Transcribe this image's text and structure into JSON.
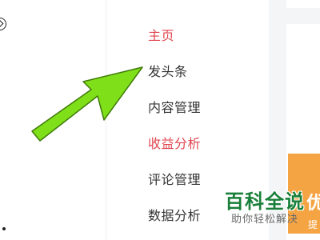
{
  "nav": {
    "items": [
      {
        "label": "主页",
        "active": true
      },
      {
        "label": "发头条",
        "active": false
      },
      {
        "label": "内容管理",
        "active": false
      },
      {
        "label": "收益分析",
        "active": true
      },
      {
        "label": "评论管理",
        "active": false
      },
      {
        "label": "数据分析",
        "active": false
      }
    ]
  },
  "watermark": {
    "title": "百科全说",
    "subtitle": "助你轻松解决"
  },
  "orange_banner": {
    "text": "优",
    "text2": "提"
  },
  "annotation": {
    "icon": "arrow-icon",
    "color": "#7fe01a"
  },
  "colors": {
    "active_nav": "#e0454e",
    "default_nav": "#333333",
    "brand_green": "#1a7f3a",
    "orange": "#f5a443"
  }
}
